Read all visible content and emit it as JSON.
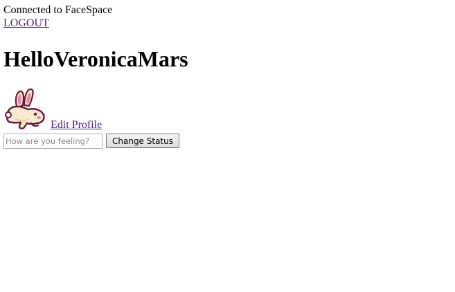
{
  "connection": {
    "text": "Connected to FaceSpace"
  },
  "logout": {
    "label": "LOGOUT"
  },
  "greeting": {
    "text": "HelloVeronicaMars"
  },
  "profile": {
    "avatar_icon": "bunny-avatar-icon",
    "edit_label": "Edit Profile"
  },
  "status": {
    "placeholder": "How are you feeling?",
    "value": "",
    "button_label": "Change Status"
  },
  "colors": {
    "link_visited": "#551a8b",
    "text": "#000000",
    "background": "#ffffff"
  }
}
